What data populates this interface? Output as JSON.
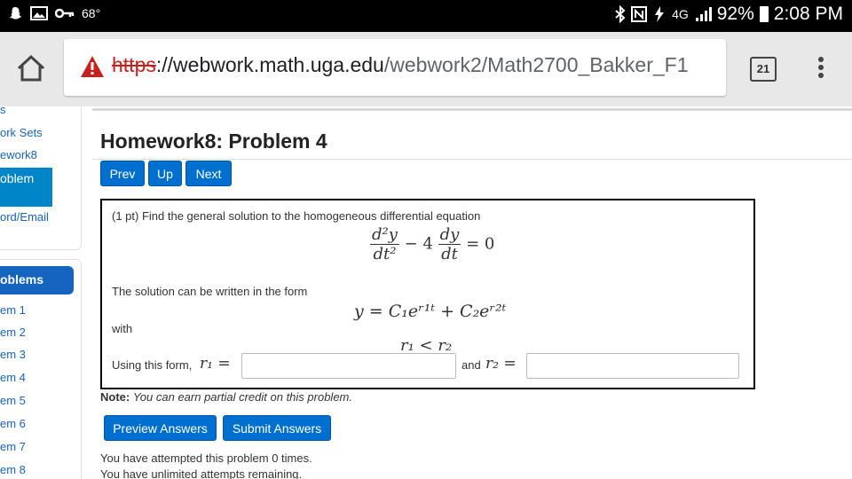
{
  "statusbar": {
    "temperature": "68°",
    "battery_percent": "92%",
    "time": "2:08 PM",
    "network": "4G",
    "icons": [
      "snapchat-icon",
      "gallery-icon",
      "key-icon",
      "bluetooth-icon",
      "nfc-icon",
      "charging-icon",
      "signal-icon",
      "battery-icon"
    ]
  },
  "browser": {
    "url_scheme": "https",
    "url_rest_host": "://webwork.math.uga.edu",
    "url_path": "/webwork2/Math2700_Bakker_F1",
    "tab_count": "21"
  },
  "sidebar": {
    "links": [
      "s",
      "ork Sets",
      "ework8"
    ],
    "active": "oblem",
    "password_link": "ord/Email",
    "problems_heading": "oblems",
    "problems": [
      "em 1",
      "em 2",
      "em 3",
      "em 4",
      "em 5",
      "em 6",
      "em 7",
      "em 8"
    ]
  },
  "main": {
    "title": "Homework8: Problem 4",
    "nav": {
      "prev": "Prev",
      "up": "Up",
      "next": "Next"
    },
    "problem": {
      "intro": "(1 pt) Find the general solution to the homogeneous differential equation",
      "equation": {
        "num1": "d²y",
        "den1": "dt²",
        "minus": "− 4",
        "num2": "dy",
        "den2": "dt",
        "rhs": "= 0"
      },
      "form_text": "The solution can be written in the form",
      "solution_form": "y = C₁eʳ¹ᵗ + C₂eʳ²ᵗ",
      "with_text": "with",
      "condition": "r₁ < r₂",
      "using_text": "Using this form,",
      "r1_label": "r₁ =",
      "and_text": "and",
      "r2_label": "r₂ =",
      "r1_value": "",
      "r2_value": ""
    },
    "note_bold": "Note:",
    "note_italic": "You can earn partial credit on this problem.",
    "buttons": {
      "preview": "Preview Answers",
      "submit": "Submit Answers"
    },
    "attempts": "You have attempted this problem 0 times.",
    "remaining": "You have unlimited attempts remaining."
  },
  "colors": {
    "accent": "#0070d0",
    "sidebar_active": "#0085c8",
    "warning": "#c5221f"
  }
}
